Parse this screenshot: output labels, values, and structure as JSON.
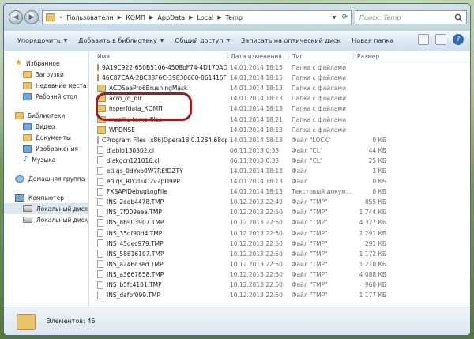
{
  "address": {
    "crumbs": [
      "Пользователи",
      "КОМП",
      "AppData",
      "Local",
      "Temp"
    ],
    "search_placeholder": "Поиск: Temp"
  },
  "toolbar": {
    "organize": "Упорядочить",
    "add_to_library": "Добавить в библиотеку",
    "share": "Общий доступ",
    "burn": "Записать на оптический диск",
    "new_folder": "Новая папка"
  },
  "nav": {
    "favorites": {
      "title": "Избранное",
      "items": [
        "Загрузки",
        "Недавние места",
        "Рабочий стол"
      ]
    },
    "libraries": {
      "title": "Библиотеки",
      "items": [
        "Видео",
        "Документы",
        "Изображения",
        "Музыка"
      ]
    },
    "homegroup": "Домашняя группа",
    "computer": {
      "title": "Компьютер",
      "items": [
        "Локальный диск (C",
        "Локальный диск (D"
      ]
    }
  },
  "columns": {
    "name": "Имя",
    "date": "Дата изменения",
    "type": "Тип",
    "size": "Размер"
  },
  "files": [
    {
      "name": "9A19C922-650B5106-4508bF74-4D170AD0",
      "date": "14.01.2014 18:15",
      "type": "Папка с файлами",
      "size": "",
      "kind": "folder"
    },
    {
      "name": "46C87CAA-2BC38F6C-39830660-861415F2",
      "date": "14.01.2014 18:15",
      "type": "Папка с файлами",
      "size": "",
      "kind": "folder"
    },
    {
      "name": "ACDSeePro6BrushingMask",
      "date": "14.01.2014 18:13",
      "type": "Папка с файлами",
      "size": "",
      "kind": "folder"
    },
    {
      "name": "acro_rd_dir",
      "date": "14.01.2014 18:13",
      "type": "Папка с файлами",
      "size": "",
      "kind": "folder"
    },
    {
      "name": "hsperfdata_КОМП",
      "date": "14.01.2014 18:13",
      "type": "Папка с файлами",
      "size": "",
      "kind": "folder"
    },
    {
      "name": "mozilla-temp-files",
      "date": "14.01.2014 18:21",
      "type": "Папка с файлами",
      "size": "",
      "kind": "folder"
    },
    {
      "name": "WPDNSE",
      "date": "14.01.2014 18:13",
      "type": "Папка с файлами",
      "size": "",
      "kind": "folder"
    },
    {
      "name": "CProgram Files (x86)Opera18.0.1284.68op...",
      "date": "14.01.2014 18:13",
      "type": "Файл \"LOCK\"",
      "size": "0 КБ",
      "kind": "file"
    },
    {
      "name": "diablo130302.cl",
      "date": "06.11.2013 0:33",
      "type": "Файл \"CL\"",
      "size": "44 КБ",
      "kind": "file"
    },
    {
      "name": "diakgcn121016.cl",
      "date": "06.11.2013 0:33",
      "type": "Файл \"CL\"",
      "size": "25 КБ",
      "kind": "file"
    },
    {
      "name": "etilqs_0dYxo0W7REfDZTY",
      "date": "14.01.2014 18:13",
      "type": "Файл",
      "size": "3 КБ",
      "kind": "file"
    },
    {
      "name": "etilqs_RlYzLuD2v2pD9PP",
      "date": "14.01.2014 18:13",
      "type": "Файл",
      "size": "0 КБ",
      "kind": "file"
    },
    {
      "name": "FXSAPIDebugLogFile",
      "date": "14.01.2014 18:13",
      "type": "Текстовый докум...",
      "size": "0 КБ",
      "kind": "file"
    },
    {
      "name": "INS_2eeb4478.TMP",
      "date": "10.12.2013 22:49",
      "type": "Файл \"TMP\"",
      "size": "855 КБ",
      "kind": "file"
    },
    {
      "name": "INS_7f009eea.TMP",
      "date": "10.12.2013 22:50",
      "type": "Файл \"TMP\"",
      "size": "1 744 КБ",
      "kind": "file"
    },
    {
      "name": "INS_8b903907.TMP",
      "date": "10.12.2013 22:50",
      "type": "Файл \"TMP\"",
      "size": "4 327 КБ",
      "kind": "file"
    },
    {
      "name": "INS_35df90d4.TMP",
      "date": "10.12.2013 22:50",
      "type": "Файл \"TMP\"",
      "size": "1 291 КБ",
      "kind": "file"
    },
    {
      "name": "INS_45dec979.TMP",
      "date": "10.12.2013 22:50",
      "type": "Файл \"TMP\"",
      "size": "291 КБ",
      "kind": "file"
    },
    {
      "name": "INS_58616107.TMP",
      "date": "10.12.2013 22:50",
      "type": "Файл \"TMP\"",
      "size": "1 172 КБ",
      "kind": "file"
    },
    {
      "name": "INS_a246c3ed.TMP",
      "date": "10.12.2013 22:50",
      "type": "Файл \"TMP\"",
      "size": "1 210 КБ",
      "kind": "file"
    },
    {
      "name": "INS_a3667858.TMP",
      "date": "10.12.2013 22:50",
      "type": "Файл \"TMP\"",
      "size": "4 088 КБ",
      "kind": "file"
    },
    {
      "name": "INS_b5fc4101.TMP",
      "date": "10.12.2013 22:50",
      "type": "Файл \"TMP\"",
      "size": "960 КБ",
      "kind": "file"
    },
    {
      "name": "INS_dafbf099.TMP",
      "date": "10.12.2013 22:50",
      "type": "Файл \"TMP\"",
      "size": "1 177 КБ",
      "kind": "file"
    }
  ],
  "status": {
    "count": "Элементов: 46"
  },
  "colors": {
    "highlight": "#a11d1d",
    "selection": "#dbe6f1"
  }
}
